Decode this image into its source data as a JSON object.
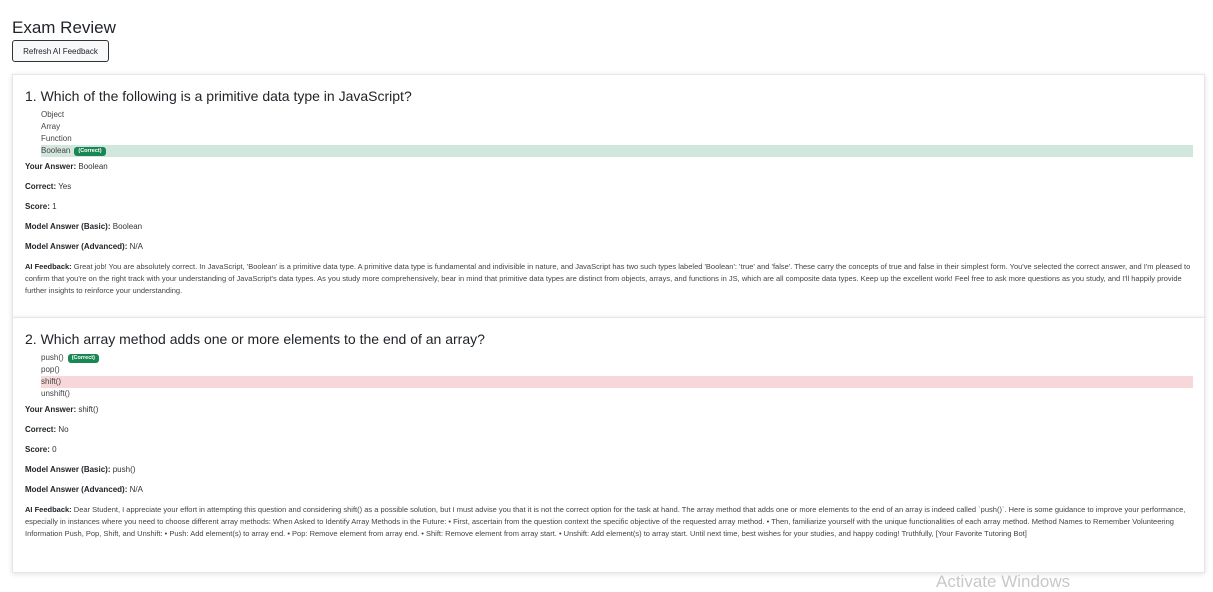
{
  "page": {
    "title": "Exam Review",
    "refresh_label": "Refresh AI Feedback"
  },
  "questions": [
    {
      "title": "1. Which of the following is a primitive data type in JavaScript?",
      "options": [
        "Object",
        "Array",
        "Function",
        "Boolean"
      ],
      "correct_badge": "(Correct)",
      "your_answer_label": "Your Answer:",
      "your_answer": "Boolean",
      "correct_label": "Correct:",
      "correct": "Yes",
      "score_label": "Score:",
      "score": "1",
      "basic_label": "Model Answer (Basic):",
      "basic": "Boolean",
      "advanced_label": "Model Answer (Advanced):",
      "advanced": "N/A",
      "feedback_label": "AI Feedback:",
      "feedback": "Great job! You are absolutely correct. In JavaScript, 'Boolean' is a primitive data type. A primitive data type is fundamental and indivisible in nature, and JavaScript has two such types labeled 'Boolean': 'true' and 'false'. These carry the concepts of true and false in their simplest form. You've selected the correct answer, and I'm pleased to confirm that you're on the right track with your understanding of JavaScript's data types. As you study more comprehensively, bear in mind that primitive data types are distinct from objects, arrays, and functions in JS, which are all composite data types. Keep up the excellent work! Feel free to ask more questions as you study, and I'll happily provide further insights to reinforce your understanding."
    },
    {
      "title": "2. Which array method adds one or more elements to the end of an array?",
      "options": [
        "push()",
        "pop()",
        "shift()",
        "unshift()"
      ],
      "correct_badge": "(Correct)",
      "your_answer_label": "Your Answer:",
      "your_answer": "shift()",
      "correct_label": "Correct:",
      "correct": "No",
      "score_label": "Score:",
      "score": "0",
      "basic_label": "Model Answer (Basic):",
      "basic": "push()",
      "advanced_label": "Model Answer (Advanced):",
      "advanced": "N/A",
      "feedback_label": "AI Feedback:",
      "feedback": "Dear Student, I appreciate your effort in attempting this question and considering shift() as a possible solution, but I must advise you that it is not the correct option for the task at hand. The array method that adds one or more elements to the end of an array is indeed called `push()`. Here is some guidance to improve your performance, especially in instances where you need to choose different array methods: When Asked to Identify Array Methods in the Future: • First, ascertain from the question context the specific objective of the requested array method. • Then, familiarize yourself with the unique functionalities of each array method. Method Names to Remember Volunteering Information Push, Pop, Shift, and Unshift: • Push: Add element(s) to array end. • Pop: Remove element from array end. • Shift: Remove element from array start. • Unshift: Add element(s) to array start. Until next time, best wishes for your studies, and happy coding! Truthfully, [Your Favorite Tutoring Bot]"
    }
  ],
  "watermark": "Activate Windows"
}
